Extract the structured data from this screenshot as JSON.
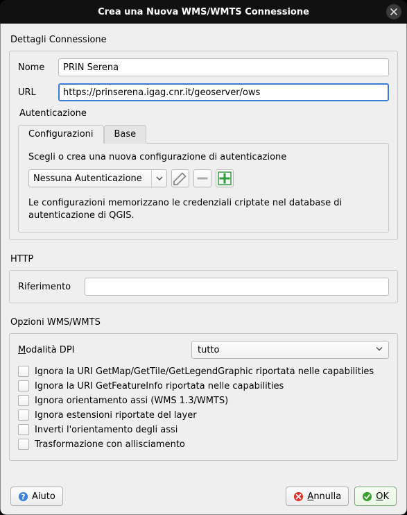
{
  "window": {
    "title": "Crea una Nuova WMS/WMTS Connessione"
  },
  "details": {
    "title": "Dettagli Connessione",
    "name_label": "Nome",
    "name_value": "PRIN Serena",
    "url_label": "URL",
    "url_value": "https://prinserena.igag.cnr.it/geoserver/ows"
  },
  "auth": {
    "title": "Autenticazione",
    "tabs": {
      "config": "Configurazioni",
      "basic": "Base"
    },
    "hint": "Scegli o crea una nuova configurazione di autenticazione",
    "combo_value": "Nessuna Autenticazione",
    "note": "Le configurazioni memorizzano le credenziali criptate nel database di autenticazione di QGIS."
  },
  "http": {
    "title": "HTTP",
    "ref_label": "Riferimento",
    "ref_value": ""
  },
  "wms": {
    "title": "Opzioni WMS/WMTS",
    "dpi_label": "Modalità DPI",
    "dpi_value": "tutto",
    "checks": [
      "Ignora la URI GetMap/GetTile/GetLegendGraphic riportata nelle capabilities",
      "Ignora la URI GetFeatureInfo riportata nelle capabilities",
      "Ignora orientamento assi (WMS 1.3/WMTS)",
      "Ignora estensioni riportate del layer",
      "Inverti l'orientamento degli assi",
      "Trasformazione con allisciamento"
    ]
  },
  "footer": {
    "help": "Aiuto",
    "cancel": "Annulla",
    "ok": "OK"
  }
}
